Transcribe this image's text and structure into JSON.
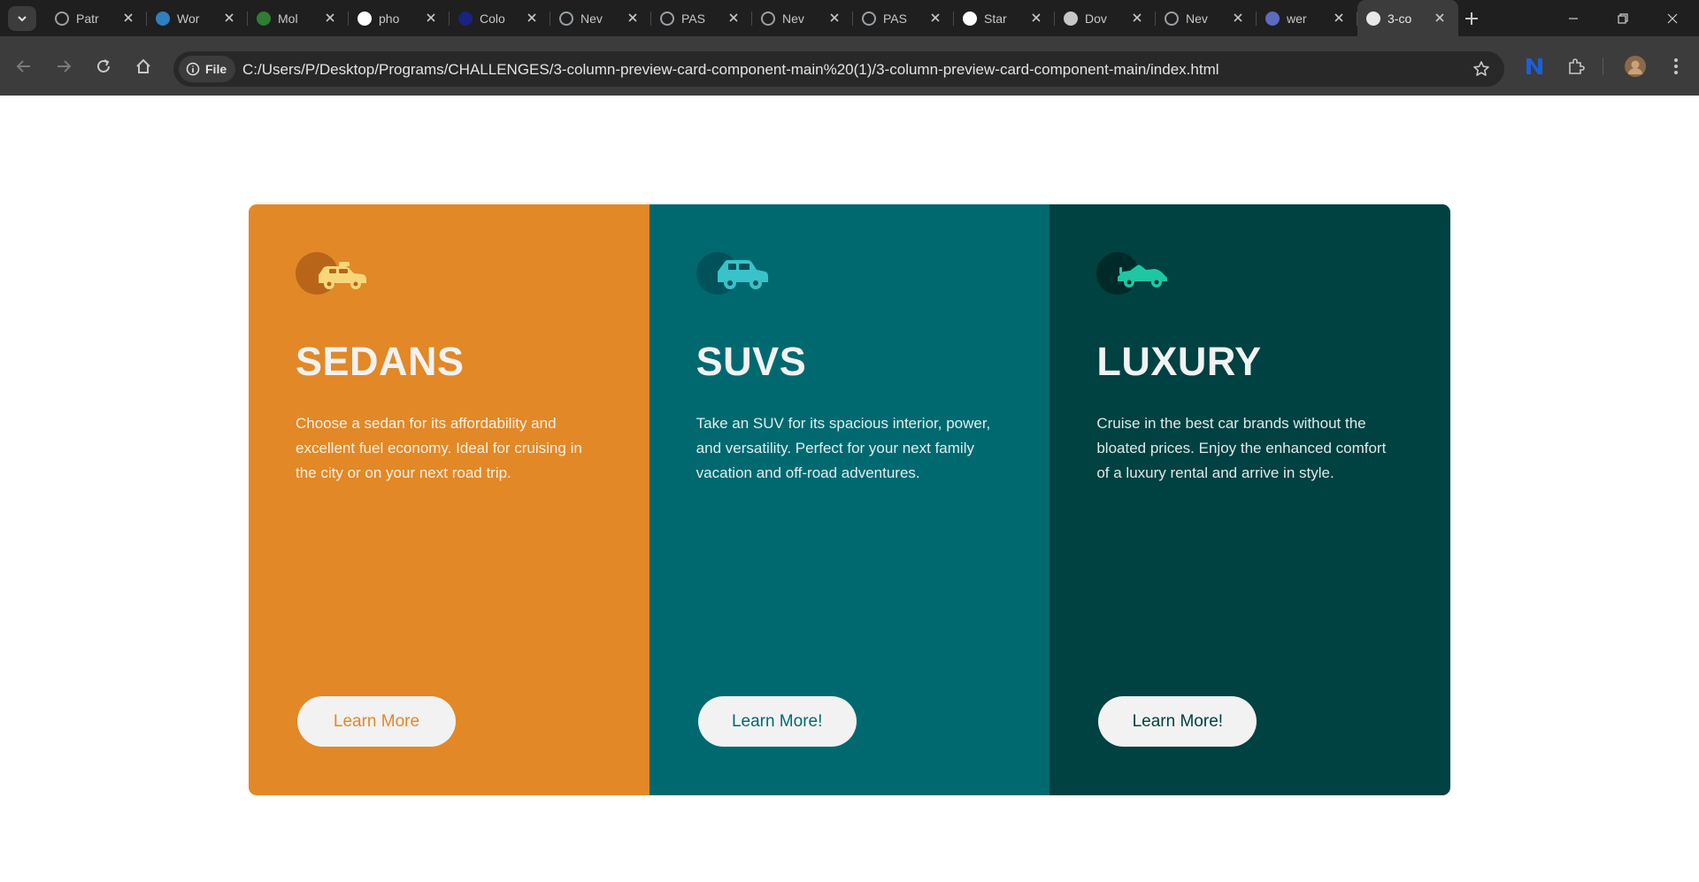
{
  "browser": {
    "tabs": [
      {
        "label": "Patr",
        "favicon": "globe-icon",
        "color": "#9aa0a6"
      },
      {
        "label": "Wor",
        "favicon": "s-letter-icon",
        "color": "#2f7fc1"
      },
      {
        "label": "Mol",
        "favicon": "owl-icon",
        "color": "#2e7d32"
      },
      {
        "label": "pho",
        "favicon": "google-icon",
        "color": "#ffffff"
      },
      {
        "label": "Colo",
        "favicon": "color-icon",
        "color": "#1a237e"
      },
      {
        "label": "Nev",
        "favicon": "chrome-icon",
        "color": "#9aa0a6"
      },
      {
        "label": "PAS",
        "favicon": "globe-icon",
        "color": "#9aa0a6"
      },
      {
        "label": "Nev",
        "favicon": "chrome-icon",
        "color": "#9aa0a6"
      },
      {
        "label": "PAS",
        "favicon": "globe-icon",
        "color": "#9aa0a6"
      },
      {
        "label": "Star",
        "favicon": "openai-icon",
        "color": "#ffffff"
      },
      {
        "label": "Dov",
        "favicon": "download-icon",
        "color": "#c7c7c7"
      },
      {
        "label": "Nev",
        "favicon": "chrome-icon",
        "color": "#9aa0a6"
      },
      {
        "label": "wer",
        "favicon": "terminal-icon",
        "color": "#5c6bc0"
      },
      {
        "label": "3-co",
        "favicon": "page-icon",
        "color": "#e8e8e8",
        "active": true
      }
    ],
    "site_info_label": "File",
    "url": "C:/Users/P/Desktop/Programs/CHALLENGES/3-column-preview-card-component-main%20(1)/3-column-preview-card-component-main/index.html"
  },
  "cards": [
    {
      "id": "sedans",
      "title": "SEDANS",
      "text": "Choose a sedan for its affordability and excellent fuel economy. Ideal for cruising in the city or on your next road trip.",
      "button": "Learn More",
      "icon": "sedan-car-icon",
      "bg": "#e28827",
      "icon_bg": "#b8651a",
      "icon_color": "#f8d77a",
      "button_text_color": "#e28827"
    },
    {
      "id": "suvs",
      "title": "SUVS",
      "text": "Take an SUV for its spacious interior, power, and versatility. Perfect for your next family vacation and off-road adventures.",
      "button": "Learn More!",
      "icon": "suv-car-icon",
      "bg": "#006970",
      "icon_bg": "#00525a",
      "icon_color": "#39c2c9",
      "button_text_color": "#006970"
    },
    {
      "id": "luxury",
      "title": "LUXURY",
      "text": "Cruise in the best car brands without the bloated prices. Enjoy the enhanced comfort of a luxury rental and arrive in style.",
      "button": "Learn More!",
      "icon": "luxury-car-icon",
      "bg": "#004141",
      "icon_bg": "#002a2a",
      "icon_color": "#1ec7a4",
      "button_text_color": "#004141"
    }
  ]
}
